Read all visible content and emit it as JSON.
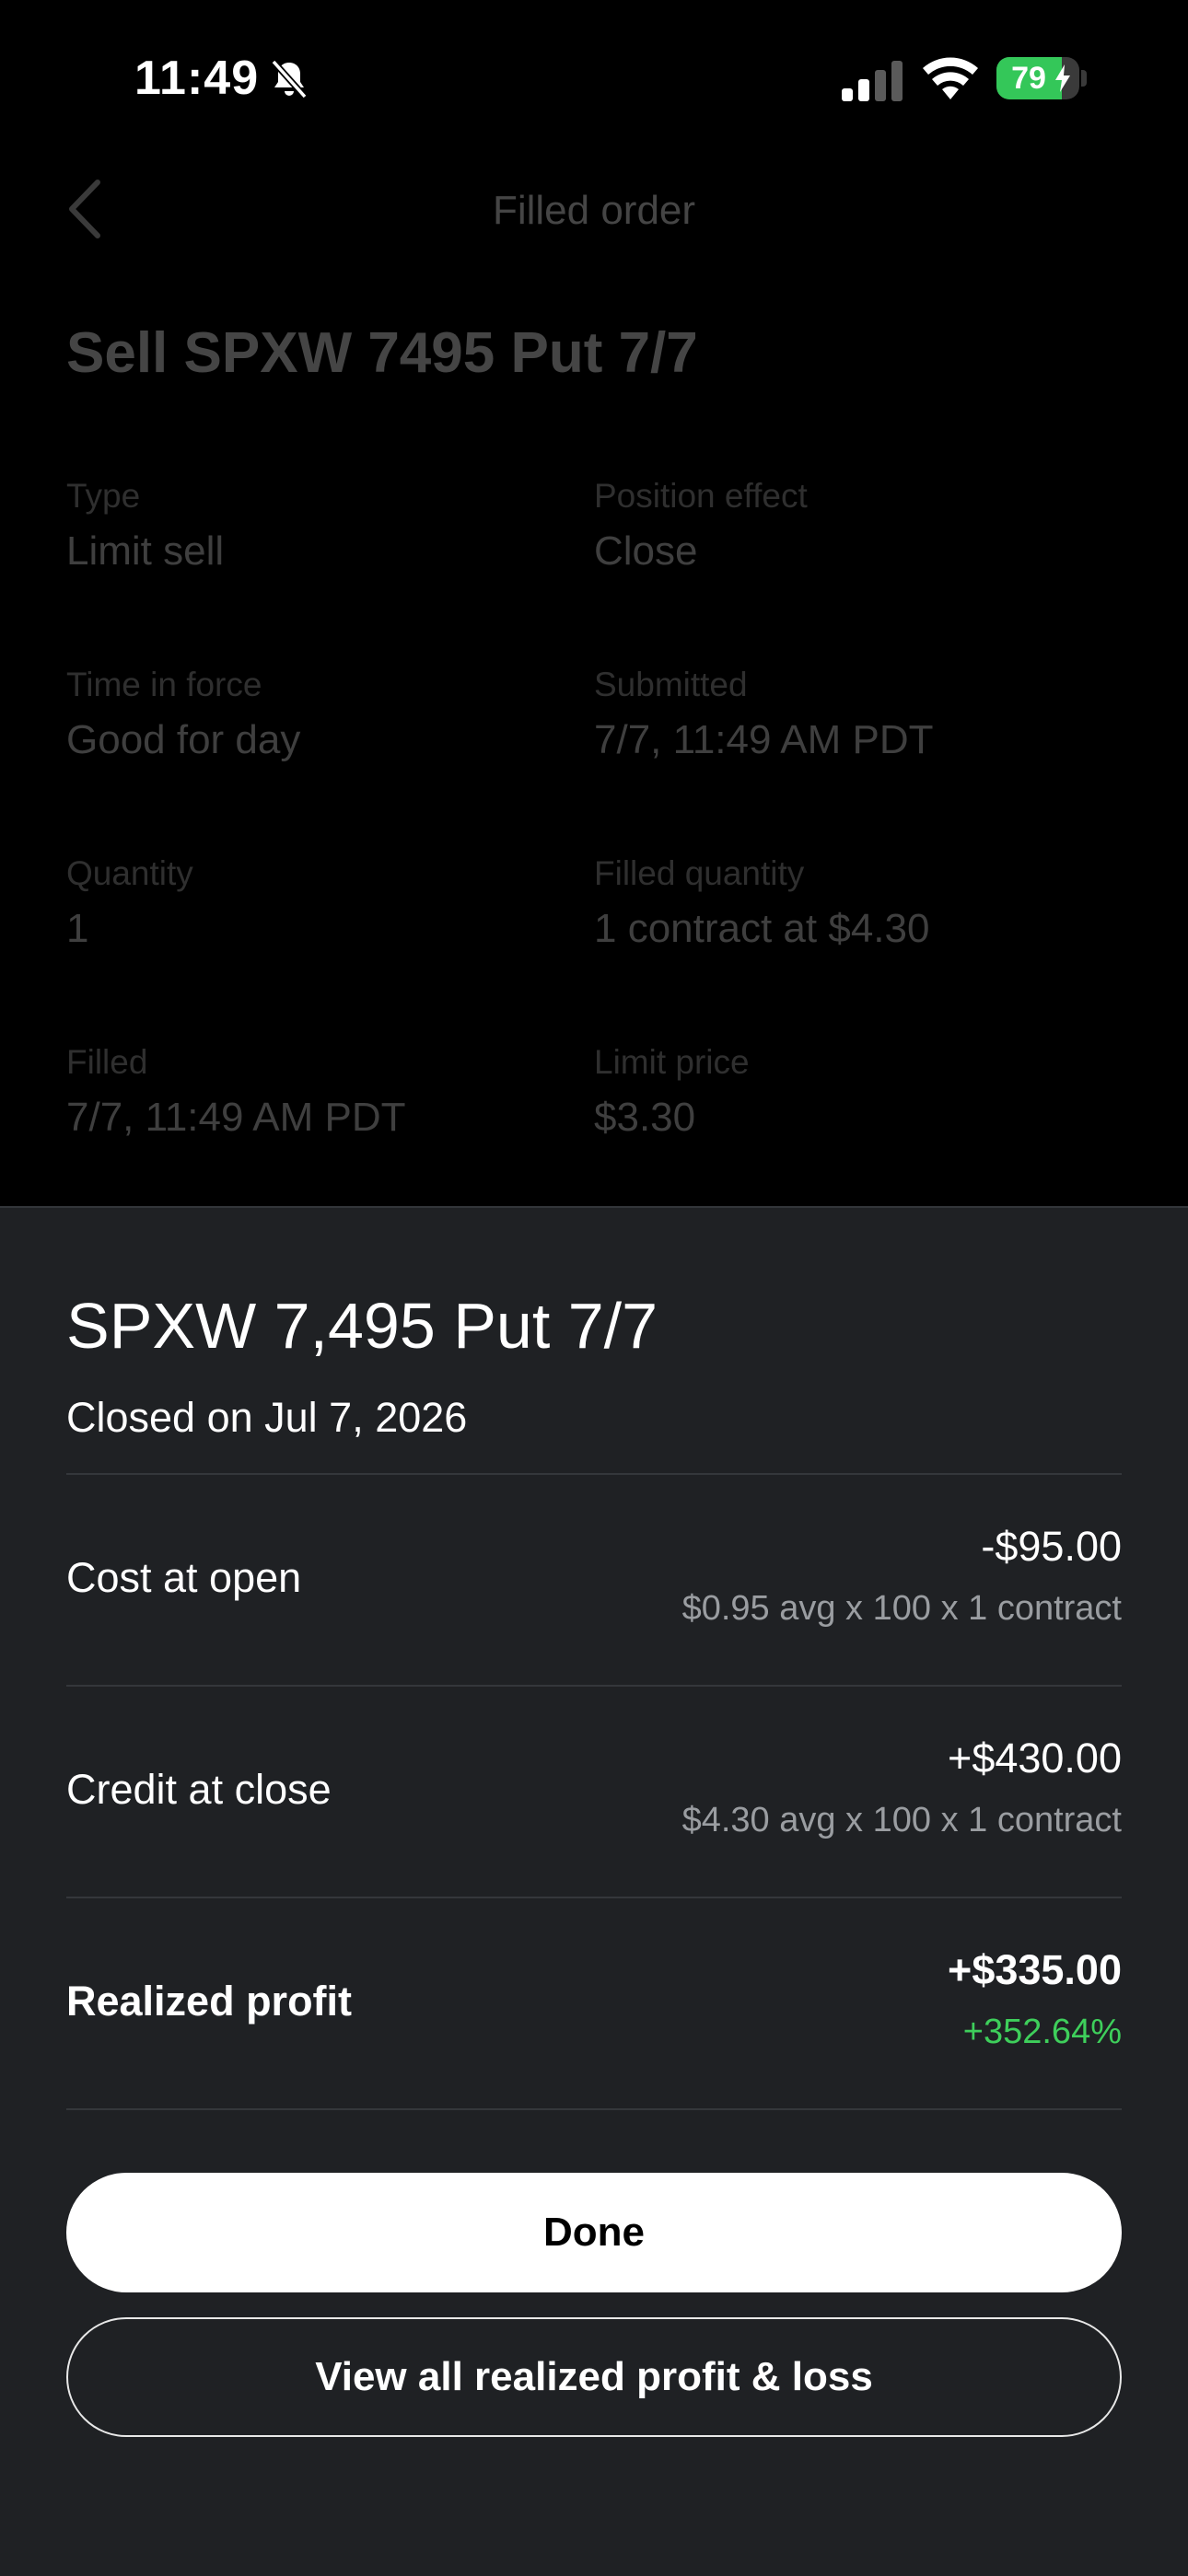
{
  "status_bar": {
    "time": "11:49",
    "battery": "79",
    "battery_level": 0.79,
    "icons": [
      "bell-slash-icon",
      "signal-icon",
      "wifi-icon",
      "battery-icon",
      "charging-bolt-icon"
    ]
  },
  "background_screen": {
    "nav_title": "Filled order",
    "back_icon": "chevron-left-icon",
    "order_title": "Sell SPXW 7495 Put 7/7",
    "fields": [
      {
        "label": "Type",
        "value": "Limit sell"
      },
      {
        "label": "Position effect",
        "value": "Close"
      },
      {
        "label": "Time in force",
        "value": "Good for day"
      },
      {
        "label": "Submitted",
        "value": "7/7, 11:49 AM PDT"
      },
      {
        "label": "Quantity",
        "value": "1"
      },
      {
        "label": "Filled quantity",
        "value": "1 contract at $4.30"
      },
      {
        "label": "Filled",
        "value": "7/7, 11:49 AM PDT"
      },
      {
        "label": "Limit price",
        "value": "$3.30"
      }
    ]
  },
  "sheet": {
    "title": "SPXW 7,495 Put 7/7",
    "subtitle": "Closed on Jul 7, 2026",
    "rows": [
      {
        "label": "Cost at open",
        "value": "-$95.00",
        "detail": "$0.95 avg x 100 x 1 contract"
      },
      {
        "label": "Credit at close",
        "value": "+$430.00",
        "detail": "$4.30 avg x 100 x 1 contract"
      },
      {
        "label": "Realized profit",
        "value": "+$335.00",
        "detail": "+352.64%"
      }
    ],
    "done_label": "Done",
    "view_all_label": "View all realized profit & loss"
  },
  "colors": {
    "sheet_background": "#1f2124",
    "profit_green": "#3ecf5b",
    "battery_green": "#34c759"
  }
}
